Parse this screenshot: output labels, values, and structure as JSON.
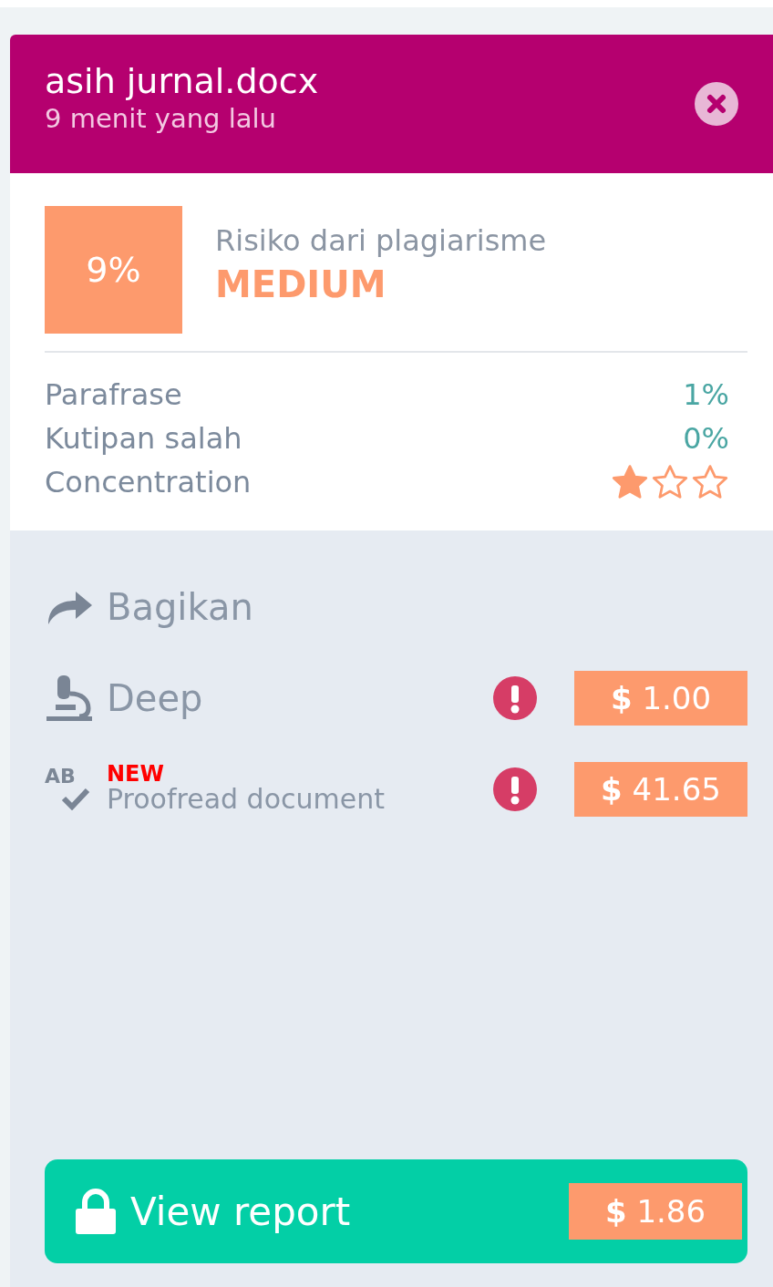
{
  "file": {
    "name": "asih jurnal.docx",
    "time": "9 menit yang lalu"
  },
  "risk": {
    "score": "9%",
    "label": "Risiko dari plagiarisme",
    "level_text": "MEDIUM"
  },
  "stats": [
    {
      "kind": "value",
      "label": "Parafrase",
      "value": "1%"
    },
    {
      "kind": "value",
      "label": "Kutipan salah",
      "value": "0%"
    },
    {
      "kind": "stars",
      "label": "Concentration",
      "stars": 1
    }
  ],
  "actions": [
    {
      "kind": "share",
      "label": "Bagikan"
    },
    {
      "kind": "deep",
      "label": "Deep",
      "warning": true,
      "price": "**$** 1.00"
    },
    {
      "kind": "proofread",
      "icon_text": "AB",
      "badge": "NEW",
      "label": "Proofread document",
      "warning": true,
      "price": "**$** 41.65"
    }
  ],
  "view_report": {
    "label": "View report",
    "price": "**$** 1.86"
  }
}
